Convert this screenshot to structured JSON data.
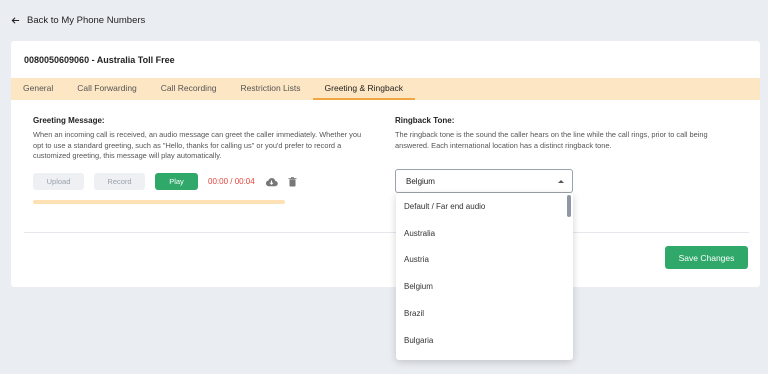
{
  "back_link": {
    "label": "Back to My Phone Numbers",
    "icon": "arrow-left-icon"
  },
  "card": {
    "title": "0080050609060 - Australia Toll Free"
  },
  "tabs": [
    {
      "label": "General",
      "active": false
    },
    {
      "label": "Call Forwarding",
      "active": false
    },
    {
      "label": "Call Recording",
      "active": false
    },
    {
      "label": "Restriction Lists",
      "active": false
    },
    {
      "label": "Greeting & Ringback",
      "active": true
    }
  ],
  "greeting": {
    "title": "Greeting Message:",
    "description": "When an incoming call is received, an audio message can greet the caller immediately. Whether you opt to use a standard greeting, such as \"Hello, thanks for calling us\" or you'd prefer to record a customized greeting, this message will play automatically.",
    "upload_label": "Upload",
    "record_label": "Record",
    "play_label": "Play",
    "time": "00:00 / 00:04",
    "progress": 0,
    "download_icon": "cloud-download-icon",
    "delete_icon": "trash-icon"
  },
  "ringback": {
    "title": "Ringback Tone:",
    "description": "The ringback tone is the sound the caller hears on the line while the call rings, prior to call being answered. Each international location has a distinct ringback tone.",
    "selected": "Belgium",
    "options": [
      "Default / Far end audio",
      "Australia",
      "Austria",
      "Belgium",
      "Brazil",
      "Bulgaria"
    ]
  },
  "save_label": "Save Changes",
  "colors": {
    "accent_green": "#2fa86a",
    "tab_bg": "#fde6c3",
    "tab_active": "#f0a640",
    "time_red": "#e0463c"
  }
}
